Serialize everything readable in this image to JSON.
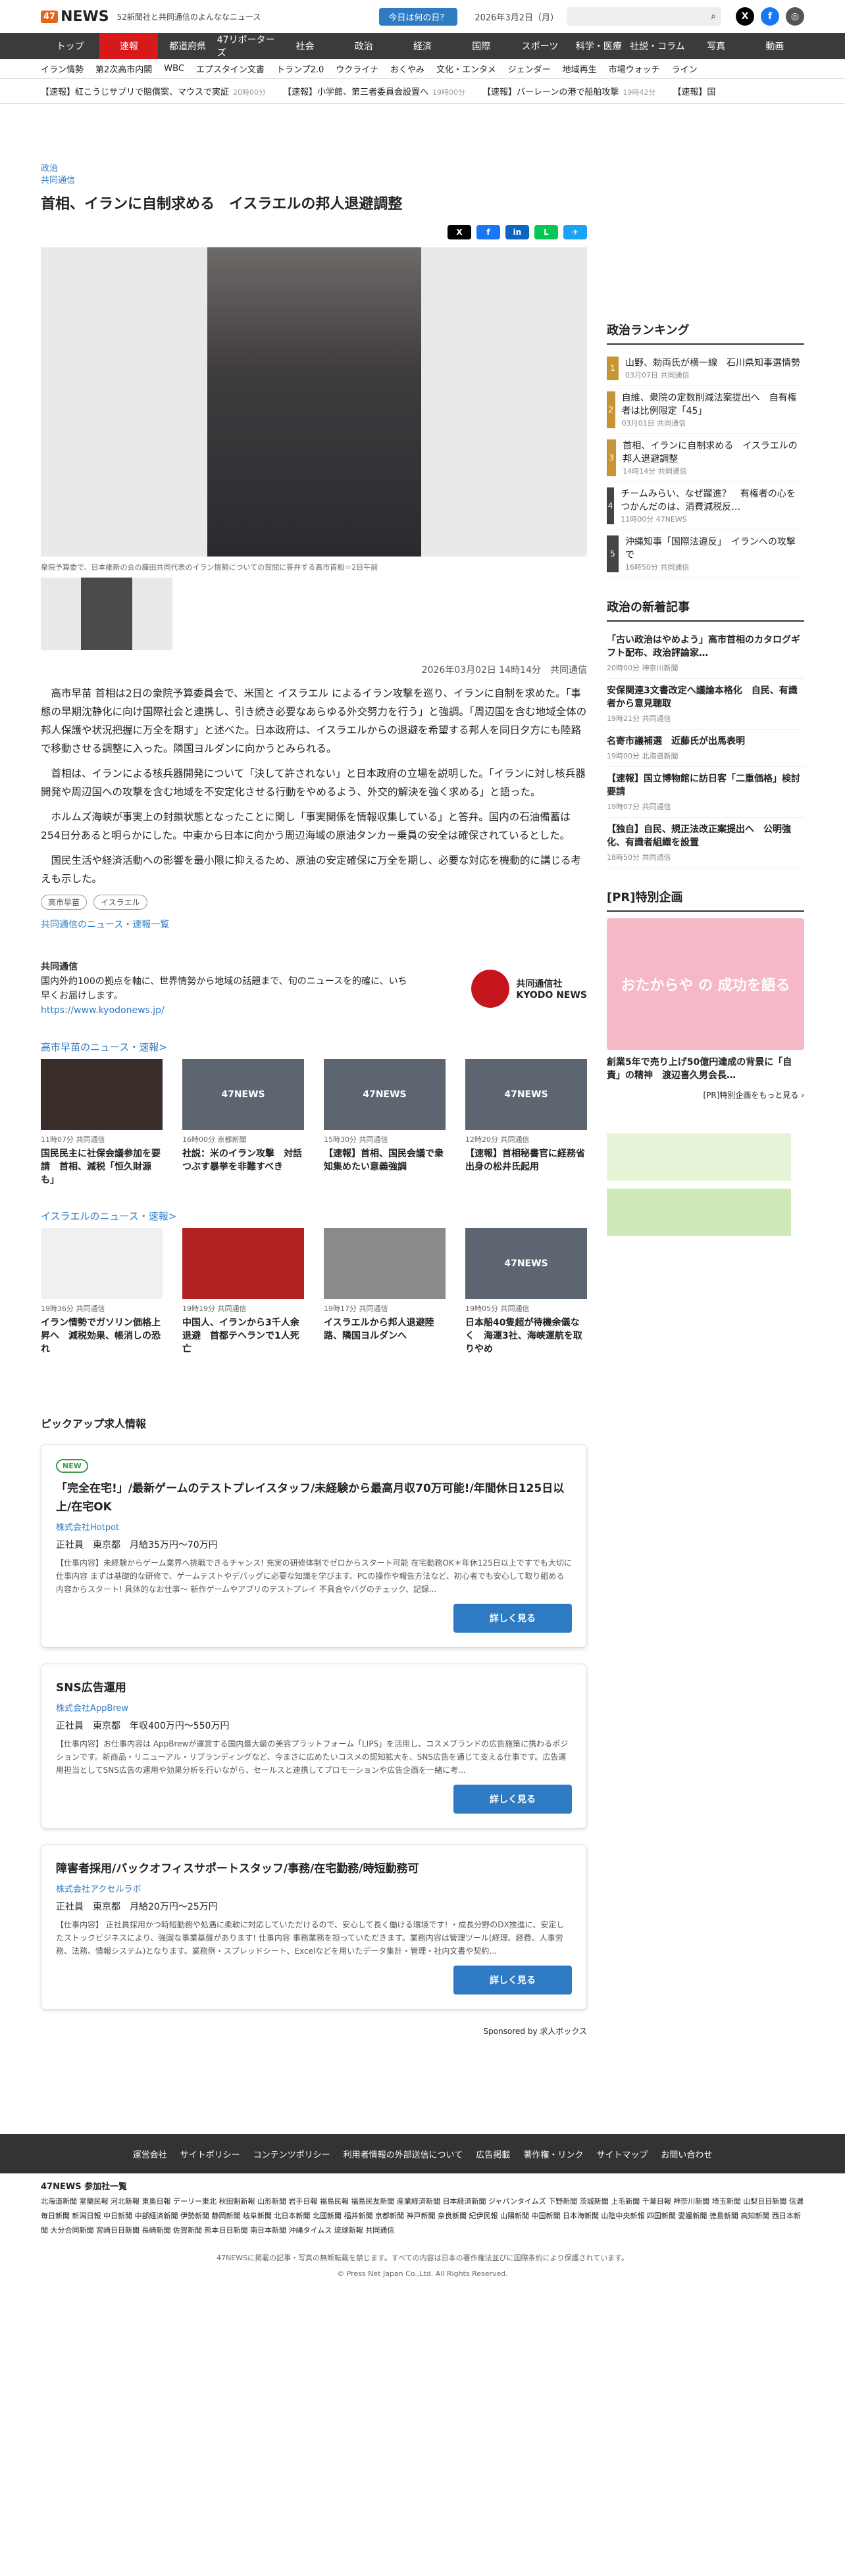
{
  "header": {
    "logo": "47NEWS",
    "tagline": "52新聞社と共同通信のよんななニュース",
    "today_button": "今日は何の日？",
    "date": "2026年3月2日（月）"
  },
  "nav": [
    "トップ",
    "速報",
    "都道府県",
    "47リポーターズ",
    "社会",
    "政治",
    "経済",
    "国際",
    "スポーツ",
    "科学・医療",
    "社説・コラム",
    "写真",
    "動画"
  ],
  "subnav": [
    "イラン情勢",
    "第2次高市内閣",
    "WBC",
    "エプスタイン文書",
    "トランプ2.0",
    "ウクライナ",
    "おくやみ",
    "文化・エンタメ",
    "ジェンダー",
    "地域再生",
    "市場ウォッチ",
    "ライン"
  ],
  "ticker": [
    {
      "text": "【速報】紅こうじサプリで賠償案、マウスで実証",
      "time": "20時00分"
    },
    {
      "text": "【速報】小学館、第三者委員会設置へ",
      "time": "19時00分"
    },
    {
      "text": "【速報】バーレーンの港で船舶攻撃",
      "time": "19時42分"
    },
    {
      "text": "【速報】国",
      "time": ""
    }
  ],
  "article": {
    "category": "政治",
    "source": "共同通信",
    "title": "首相、イランに自制求める　イスラエルの邦人退避調整",
    "caption": "衆院予算委で、日本維新の会の藤田共同代表のイラン情勢についての質問に答弁する高市首相＝2日午前",
    "datetime": "2026年03月02日 14時14分",
    "agency": "共同通信",
    "paragraphs": [
      "高市早苗 首相は2日の衆院予算委員会で、米国と イスラエル によるイラン攻撃を巡り、イランに自制を求めた。「事態の早期沈静化に向け国際社会と連携し、引き続き必要なあらゆる外交努力を行う」と強調。「周辺国を含む地域全体の邦人保護や状況把握に万全を期す」と述べた。日本政府は、イスラエルからの退避を希望する邦人を同日夕方にも陸路で移動させる調整に入った。隣国ヨルダンに向かうとみられる。",
      "首相は、イランによる核兵器開発について「決して許されない」と日本政府の立場を説明した。「イランに対し核兵器開発や周辺国への攻撃を含む地域を不安定化させる行動をやめるよう、外交的解決を強く求める」と語った。",
      "ホルムズ海峡が事実上の封鎖状態となったことに関し「事実関係を情報収集している」と答弁。国内の石油備蓄は254日分あると明らかにした。中東から日本に向かう周辺海域の原油タンカー乗員の安全は確保されているとした。",
      "国民生活や経済活動への影響を最小限に抑えるため、原油の安定確保に万全を期し、必要な対応を機動的に講じる考えも示した。"
    ],
    "tags": [
      "高市早苗",
      "イスラエル"
    ],
    "more_link": "共同通信のニュース・速報一覧"
  },
  "kyodo_box": {
    "title": "共同通信",
    "text": "国内外約100の拠点を軸に、世界情勢から地域の話題まで、旬のニュースを的確に、いち早くお届けします。",
    "url": "https://www.kyodonews.jp/",
    "brand": "共同通信社",
    "brand_en": "KYODO NEWS"
  },
  "sec1": {
    "title": "高市早苗のニュース・速報>",
    "cards": [
      {
        "meta": "11時07分 共同通信",
        "title": "国民民主に社保会議参加を要請　首相、減税「恒久財源も」"
      },
      {
        "meta": "16時00分 京都新聞",
        "title": "社説：米のイラン攻撃　対話つぶす暴挙を非難すべき"
      },
      {
        "meta": "15時30分 共同通信",
        "title": "【速報】首相、国民会議で衆知集めたい意義強調"
      },
      {
        "meta": "12時20分 共同通信",
        "title": "【速報】首相秘書官に経務省出身の松井氏起用"
      }
    ]
  },
  "sec2": {
    "title": "イスラエルのニュース・速報>",
    "cards": [
      {
        "meta": "19時36分 共同通信",
        "title": "イラン情勢でガソリン価格上昇へ　減税効果、帳消しの恐れ"
      },
      {
        "meta": "19時19分 共同通信",
        "title": "中国人、イランから3千人余退避　首都テヘランで1人死亡"
      },
      {
        "meta": "19時17分 共同通信",
        "title": "イスラエルから邦人退避陸路、隣国ヨルダンへ"
      },
      {
        "meta": "19時05分 共同通信",
        "title": "日本船40隻超が待機余儀なく　海運3社、海峡運航を取りやめ"
      }
    ]
  },
  "pickup": {
    "title": "ピックアップ求人情報",
    "jobs": [
      {
        "badge": "NEW",
        "title": "「完全在宅!」/最新ゲームのテストプレイスタッフ/未経験から最高月収70万可能!/年間休日125日以上/在宅OK",
        "company": "株式会社Hotpot",
        "type": "正社員",
        "place": "東京都",
        "salary": "月給35万円〜70万円",
        "desc": "【仕事内容】未経験からゲーム業界へ挑戦できるチャンス! 充実の研修体制でゼロからスタート可能 在宅勤務OK＊年休125日以上ですでも大切に 仕事内容 まずは基礎的な研修で、ゲームテストやデバッグに必要な知識を学びます。PCの操作や報告方法など、初心者でも安心して取り組める内容からスタート! 具体的なお仕事〜 新作ゲームやアプリのテストプレイ 不具合やバグのチェック、記録..."
      },
      {
        "badge": "",
        "title": "SNS広告運用",
        "company": "株式会社AppBrew",
        "type": "正社員",
        "place": "東京都",
        "salary": "年収400万円〜550万円",
        "desc": "【仕事内容】お仕事内容は AppBrewが運営する国内最大級の美容プラットフォーム「LIPS」を活用し、コスメブランドの広告施策に携わるポジションです。新商品・リニューアル・リブランディングなど、今まさに広めたいコスメの認知拡大を、SNS広告を通じて支える仕事です。広告運用担当としてSNS広告の運用や効果分析を行いながら、セールスと連携してプロモーションや広告企画を一緒に考..."
      },
      {
        "badge": "",
        "title": "障害者採用/バックオフィスサポートスタッフ/事務/在宅勤務/時短勤務可",
        "company": "株式会社アクセルラボ",
        "type": "正社員",
        "place": "東京都",
        "salary": "月給20万円〜25万円",
        "desc": "【仕事内容】 正社員採用かつ時短勤務や処遇に柔軟に対応していただけるので、安心して長く働ける環境です! ・成長分野のDX推進に、安定したストックビジネスにより、強固な事業基盤があります! 仕事内容 事務業務を担っていただきます。業務内容は管理ツール(経理、経費、人事労務、法務、情報システム)となります。業務例・スプレッドシート、Excelなどを用いたデータ集計・管理・社内文書や契約..."
      }
    ],
    "more": "詳しく見る",
    "sponsor": "Sponsored by 求人ボックス"
  },
  "side": {
    "ranking_title": "政治ランキング",
    "ranking": [
      {
        "n": "1",
        "title": "山野、勅両氏が横一線　石川県知事選情勢",
        "meta": "03月07日 共同通信"
      },
      {
        "n": "2",
        "title": "自維、衆院の定数削減法案提出へ　自有権者は比例限定「45」",
        "meta": "03月01日 共同通信"
      },
      {
        "n": "3",
        "title": "首相、イランに自制求める　イスラエルの邦人退避調整",
        "meta": "14時14分 共同通信"
      },
      {
        "n": "4",
        "title": "チームみらい、なぜ躍進？　有権者の心をつかんだのは、消費減税反…",
        "meta": "11時00分 47NEWS"
      },
      {
        "n": "5",
        "title": "沖縄知事「国際法違反」　イランへの攻撃で",
        "meta": "16時50分 共同通信"
      }
    ],
    "new_title": "政治の新着記事",
    "news": [
      {
        "title": "「古い政治はやめよう」高市首相のカタログギフト配布、政治評論家…",
        "meta": "20時00分 神奈川新聞"
      },
      {
        "title": "安保関連3文書改定へ議論本格化　自民、有識者から意見聴取",
        "meta": "19時21分 共同通信"
      },
      {
        "title": "名寄市議補選　近藤氏が出馬表明",
        "meta": "19時00分 北海道新聞"
      },
      {
        "title": "【速報】国立博物館に訪日客「二重価格」検討要請",
        "meta": "19時07分 共同通信"
      },
      {
        "title": "【独自】自民、規正法改正案提出へ　公明強化、有識者組織を設置",
        "meta": "18時50分 共同通信"
      }
    ],
    "pr_title": "[PR]特別企画",
    "pr_caption": "創業5年で売り上げ50億円達成の背景に「自責」の精神　渡辺喜久男会長…",
    "pr_more": "[PR]特別企画をもっと見る ›",
    "ad_text": "おたからや の 成功を語る"
  },
  "footer": {
    "links": [
      "運営会社",
      "サイトポリシー",
      "コンテンツポリシー",
      "利用者情報の外部送信について",
      "広告掲載",
      "著作権・リンク",
      "サイトマップ",
      "お問い合わせ"
    ],
    "members_title": "47NEWS 参加社一覧",
    "members": "北海道新聞 室蘭民報 河北新報 東奥日報 デーリー東北 秋田魁新報 山形新聞 岩手日報 福島民報 福島民友新聞 産業経済新聞 日本経済新聞 ジャパンタイムズ 下野新聞 茨城新聞 上毛新聞 千葉日報 神奈川新聞 埼玉新聞 山梨日日新聞 信濃毎日新聞 新潟日報 中日新聞 中部経済新聞 伊勢新聞 静岡新聞 岐阜新聞 北日本新聞 北國新聞 福井新聞 京都新聞 神戸新聞 奈良新聞 紀伊民報 山陽新聞 中国新聞 日本海新聞 山陰中央新報 四国新聞 愛媛新聞 徳島新聞 高知新聞 西日本新聞 大分合同新聞 宮崎日日新聞 長崎新聞 佐賀新聞 熊本日日新聞 南日本新聞 沖縄タイムス 琉球新報 共同通信",
    "notice": "47NEWSに掲載の記事・写真の無断転載を禁じます。すべての内容は日本の著作権法並びに国際条約により保護されています。",
    "copyright": "© Press Net Japan Co.,Ltd. All Rights Reserved."
  }
}
